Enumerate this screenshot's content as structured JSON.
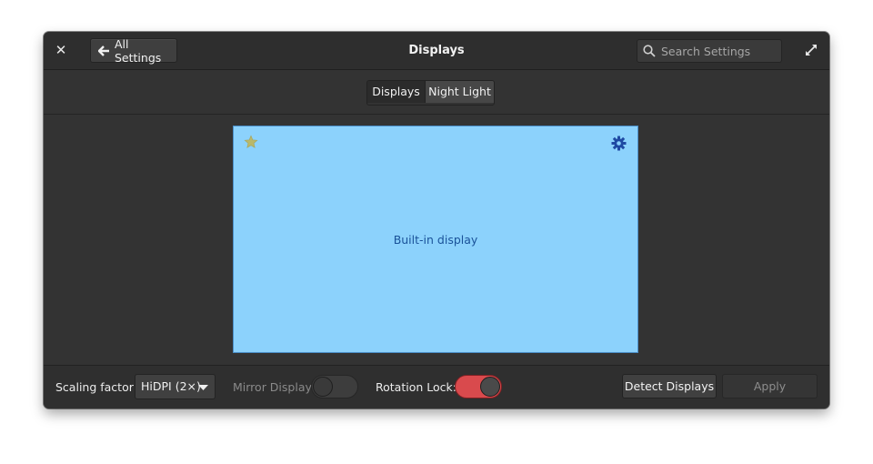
{
  "window": {
    "title": "Displays",
    "back_label": "All Settings",
    "search_placeholder": "Search Settings"
  },
  "tabs": [
    {
      "label": "Displays",
      "active": true
    },
    {
      "label": "Night Light",
      "active": false
    }
  ],
  "monitor": {
    "label": "Built-in display",
    "color": "#8cd2fc",
    "icons": [
      "star-icon",
      "gear-icon"
    ]
  },
  "bottom": {
    "scaling_label": "Scaling factor:",
    "scaling_value": "HiDPI (2×)",
    "mirror_label": "Mirror Display:",
    "mirror_on": false,
    "rotation_label": "Rotation Lock:",
    "rotation_on": true,
    "detect_label": "Detect Displays",
    "apply_label": "Apply"
  },
  "colors": {
    "accent_toggle": "#d94a4d",
    "monitor_fill": "#8cd2fc",
    "monitor_text": "#1a5299"
  }
}
